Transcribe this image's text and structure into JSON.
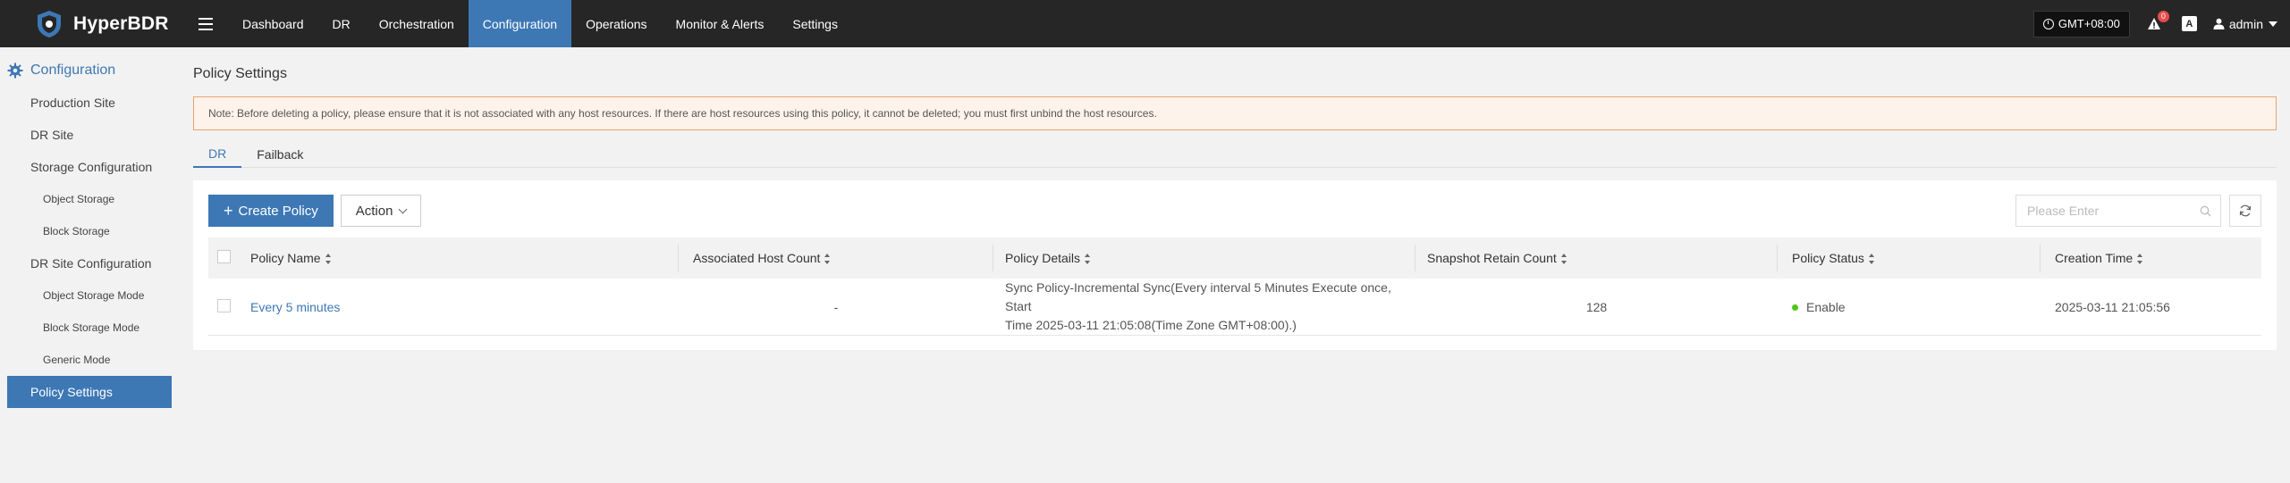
{
  "app": {
    "name": "HyperBDR"
  },
  "nav": {
    "items": [
      {
        "label": "Dashboard"
      },
      {
        "label": "DR"
      },
      {
        "label": "Orchestration"
      },
      {
        "label": "Configuration"
      },
      {
        "label": "Operations"
      },
      {
        "label": "Monitor & Alerts"
      },
      {
        "label": "Settings"
      }
    ],
    "active": "Configuration",
    "accent_color": "#3d78b5"
  },
  "topbar": {
    "timezone": "GMT+08:00",
    "alert_count": "0",
    "lang_icon_text": "A",
    "user": "admin"
  },
  "sidebar": {
    "header": "Configuration",
    "items": [
      {
        "label": "Production Site"
      },
      {
        "label": "DR Site"
      },
      {
        "label": "Storage Configuration"
      },
      {
        "label": "Object Storage"
      },
      {
        "label": "Block Storage"
      },
      {
        "label": "DR Site Configuration"
      },
      {
        "label": "Object Storage Mode"
      },
      {
        "label": "Block Storage Mode"
      },
      {
        "label": "Generic Mode"
      },
      {
        "label": "Policy Settings"
      }
    ]
  },
  "main": {
    "title": "Policy Settings",
    "notice": "Note: Before deleting a policy, please ensure that it is not associated with any host resources. If there are host resources using this policy, it cannot be deleted; you must first unbind the host resources.",
    "tabs": [
      {
        "label": "DR"
      },
      {
        "label": "Failback"
      }
    ],
    "create_button": "Create Policy",
    "action_button": "Action",
    "search_placeholder": "Please Enter",
    "table": {
      "columns": [
        "Policy Name",
        "Associated Host Count",
        "Policy Details",
        "Snapshot Retain Count",
        "Policy Status",
        "Creation Time"
      ],
      "rows": [
        {
          "name": "Every 5 minutes",
          "host_count": "-",
          "details_line1": "Sync Policy-Incremental Sync(Every interval 5 Minutes Execute once, Start",
          "details_line2": "Time 2025-03-11 21:05:08(Time Zone GMT+08:00).)",
          "snapshot_count": "128",
          "status": "Enable",
          "status_color": "#52c41a",
          "created": "2025-03-11 21:05:56"
        }
      ]
    }
  }
}
